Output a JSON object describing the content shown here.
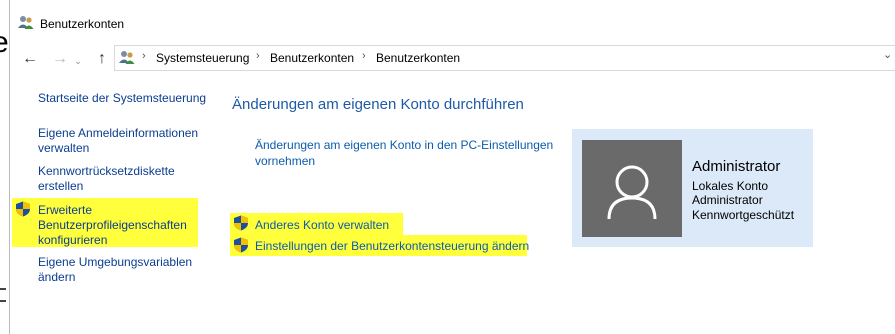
{
  "window": {
    "title": "Benutzerkonten",
    "background_edge_glyph": "e"
  },
  "breadcrumb": [
    "Systemsteuerung",
    "Benutzerkonten",
    "Benutzerkonten"
  ],
  "sidebar": {
    "items": [
      {
        "label": "Startseite der Systemsteuerung",
        "shield": false,
        "highlighted": false
      },
      {
        "label_lines": [
          "Eigene Anmeldeinformationen",
          "verwalten"
        ],
        "shield": false,
        "highlighted": false
      },
      {
        "label_lines": [
          "Kennwortrücksetzdiskette",
          "erstellen"
        ],
        "shield": false,
        "highlighted": false
      },
      {
        "label_lines": [
          "Erweiterte",
          "Benutzerprofileigenschaften",
          "konfigurieren"
        ],
        "shield": true,
        "highlighted": true
      },
      {
        "label_lines": [
          "Eigene Umgebungsvariablen",
          "ändern"
        ],
        "shield": false,
        "highlighted": false
      }
    ]
  },
  "main": {
    "heading": "Änderungen am eigenen Konto durchführen",
    "pc_settings_link_lines": [
      "Änderungen am eigenen Konto in den PC-Einstellungen",
      "vornehmen"
    ],
    "manage_other_account": "Anderes Konto verwalten",
    "uac_settings": "Einstellungen der Benutzerkontensteuerung ändern"
  },
  "account_card": {
    "name": "Administrator",
    "lines": [
      "Lokales Konto",
      "Administrator",
      "Kennwortgeschützt"
    ]
  },
  "colors": {
    "link": "#0b5cad",
    "heading": "#1e5aa8",
    "highlight": "#ffff3c",
    "card_bg": "#dbe9f8",
    "avatar_bg": "#6a6a6a"
  },
  "icons": [
    "users-icon",
    "back-arrow-icon",
    "forward-arrow-icon",
    "up-arrow-icon",
    "uac-shield-icon",
    "user-avatar-icon"
  ]
}
